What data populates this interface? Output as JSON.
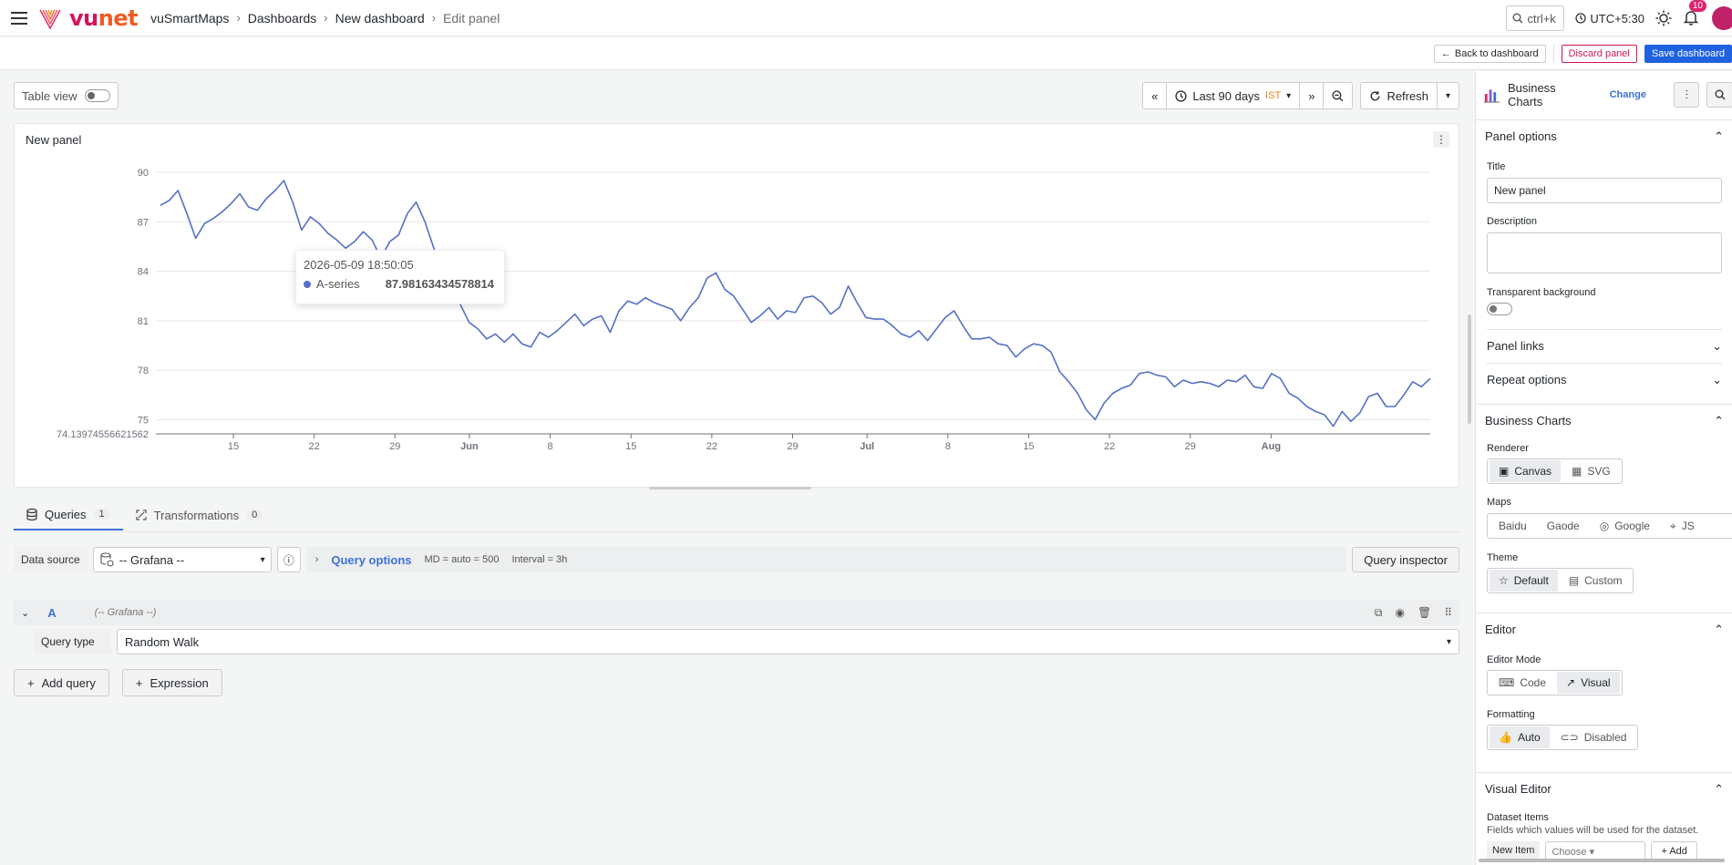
{
  "topbar": {
    "brand_vu": "vu",
    "brand_net": "net",
    "breadcrumbs": [
      "vuSmartMaps",
      "Dashboards",
      "New dashboard",
      "Edit panel"
    ],
    "search_placeholder": "ctrl+k",
    "timezone": "UTC+5:30",
    "notification_count": "10"
  },
  "subbar": {
    "back_label": "Back to dashboard",
    "discard_label": "Discard panel",
    "save_label": "Save dashboard"
  },
  "toolbar": {
    "table_view_label": "Table view",
    "time_range": "Last 90 days",
    "tz_badge": "IST",
    "refresh_label": "Refresh"
  },
  "panel": {
    "title": "New panel",
    "tooltip": {
      "time": "2026-05-09 18:50:05",
      "series": "A-series",
      "value": "87.98163434578814"
    }
  },
  "chart_data": {
    "type": "line",
    "title": "New panel",
    "xlabel": "",
    "ylabel": "",
    "x_ticks": [
      "15",
      "22",
      "29",
      "Jun",
      "8",
      "15",
      "22",
      "29",
      "Jul",
      "8",
      "15",
      "22",
      "29",
      "Aug"
    ],
    "y_ticks": [
      "90",
      "87",
      "84",
      "81",
      "78",
      "75"
    ],
    "y_min_label": "74.13974556621562",
    "ylim": [
      74.14,
      91
    ],
    "grid": true,
    "series": [
      {
        "name": "A-series",
        "color": "#5470c6",
        "values": [
          88.0,
          88.3,
          88.9,
          87.5,
          86.0,
          86.9,
          87.2,
          87.6,
          88.1,
          88.7,
          87.9,
          87.7,
          88.4,
          88.9,
          89.5,
          88.2,
          86.5,
          87.3,
          86.9,
          86.3,
          85.9,
          85.4,
          85.8,
          86.4,
          85.9,
          84.8,
          85.8,
          86.2,
          87.5,
          88.2,
          87.0,
          85.4,
          84.0,
          82.8,
          82.0,
          80.9,
          80.5,
          79.9,
          80.2,
          79.7,
          80.2,
          79.6,
          79.4,
          80.3,
          80.0,
          80.4,
          80.9,
          81.4,
          80.7,
          81.1,
          81.3,
          80.3,
          81.6,
          82.2,
          82.0,
          82.4,
          82.1,
          81.9,
          81.7,
          81.0,
          81.8,
          82.4,
          83.6,
          83.9,
          82.9,
          82.5,
          81.7,
          80.9,
          81.3,
          81.8,
          81.1,
          81.6,
          81.5,
          82.4,
          82.5,
          82.1,
          81.4,
          81.8,
          83.1,
          82.1,
          81.2,
          81.1,
          81.1,
          80.7,
          80.2,
          80.0,
          80.4,
          79.8,
          80.5,
          81.2,
          81.6,
          80.7,
          79.9,
          79.9,
          80.0,
          79.6,
          79.5,
          78.8,
          79.3,
          79.6,
          79.5,
          79.1,
          77.9,
          77.3,
          76.6,
          75.6,
          75.0,
          76.0,
          76.6,
          76.9,
          77.1,
          77.8,
          77.9,
          77.7,
          77.6,
          77.0,
          77.4,
          77.2,
          77.3,
          77.2,
          77.0,
          77.4,
          77.3,
          77.7,
          77.0,
          76.9,
          77.8,
          77.5,
          76.6,
          76.3,
          75.8,
          75.5,
          75.3,
          74.6,
          75.5,
          74.9,
          75.4,
          76.4,
          76.6,
          75.8,
          75.8,
          76.5,
          77.3,
          77.0,
          77.5
        ]
      }
    ]
  },
  "query_tabs": {
    "queries_label": "Queries",
    "queries_count": "1",
    "transformations_label": "Transformations",
    "transformations_count": "0"
  },
  "datasource": {
    "label": "Data source",
    "value": "-- Grafana --",
    "query_options_label": "Query options",
    "md": "MD = auto = 500",
    "interval": "Interval = 3h",
    "inspector_label": "Query inspector"
  },
  "query_a": {
    "letter": "A",
    "ds": "(-- Grafana --)",
    "type_label": "Query type",
    "type_value": "Random Walk"
  },
  "add": {
    "query_label": "Add query",
    "expression_label": "Expression"
  },
  "options": {
    "viz_name": "Business Charts",
    "change_label": "Change",
    "panel_options": {
      "heading": "Panel options",
      "title_label": "Title",
      "title_value": "New panel",
      "description_label": "Description",
      "transparent_label": "Transparent background",
      "links_label": "Panel links",
      "repeat_label": "Repeat options"
    },
    "business_charts": {
      "heading": "Business Charts",
      "renderer_label": "Renderer",
      "renderer_options": [
        "Canvas",
        "SVG"
      ],
      "renderer_selected": "Canvas",
      "maps_label": "Maps",
      "maps_options": [
        "Baidu",
        "Gaode",
        "Google",
        "JS"
      ],
      "theme_label": "Theme",
      "theme_options": [
        "Default",
        "Custom"
      ],
      "theme_selected": "Default"
    },
    "editor": {
      "heading": "Editor",
      "mode_label": "Editor Mode",
      "mode_options": [
        "Code",
        "Visual"
      ],
      "mode_selected": "Visual",
      "formatting_label": "Formatting",
      "formatting_options": [
        "Auto",
        "Disabled"
      ],
      "formatting_selected": "Auto"
    },
    "visual_editor": {
      "heading": "Visual Editor",
      "dataset_label": "Dataset Items",
      "dataset_desc": "Fields which values will be used for the dataset.",
      "new_item": "New Item",
      "choose": "Choose",
      "add": "Add"
    }
  },
  "colors": {
    "accent": "#3d71d9",
    "save": "#1f62e0",
    "discard": "#d4145a",
    "series": "#5470c6"
  }
}
